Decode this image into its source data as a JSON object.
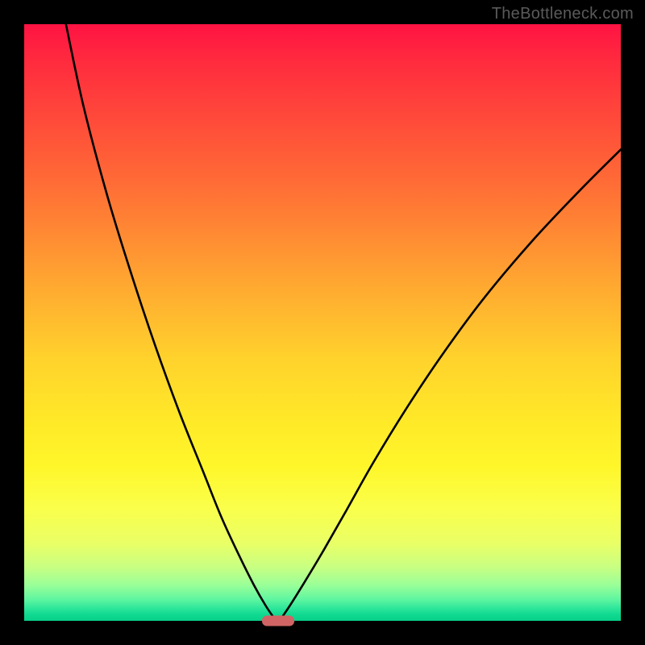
{
  "watermark": "TheBottleneck.com",
  "chart_data": {
    "type": "line",
    "title": "",
    "xlabel": "",
    "ylabel": "",
    "xlim": [
      0,
      100
    ],
    "ylim": [
      0,
      100
    ],
    "grid": false,
    "legend": false,
    "background_gradient": {
      "top": "#ff1343",
      "mid": "#ffd22c",
      "bottom": "#08d08a"
    },
    "marker": {
      "x": 42.5,
      "y": 0,
      "color": "#d06464"
    },
    "series": [
      {
        "name": "left-branch",
        "stroke": "#000000",
        "x": [
          7.0,
          10.0,
          14.0,
          18.0,
          22.0,
          26.0,
          30.0,
          33.0,
          36.0,
          38.5,
          40.5,
          42.0
        ],
        "y": [
          100.0,
          86.0,
          71.0,
          58.0,
          46.0,
          35.0,
          25.0,
          17.5,
          11.0,
          6.0,
          2.5,
          0.3
        ]
      },
      {
        "name": "right-branch",
        "stroke": "#000000",
        "x": [
          43.0,
          44.5,
          47.0,
          50.0,
          54.0,
          58.5,
          64.0,
          70.0,
          77.0,
          85.0,
          93.0,
          100.0
        ],
        "y": [
          0.3,
          2.5,
          6.5,
          11.5,
          18.5,
          26.5,
          35.5,
          44.5,
          54.0,
          63.5,
          72.0,
          79.0
        ]
      }
    ]
  }
}
